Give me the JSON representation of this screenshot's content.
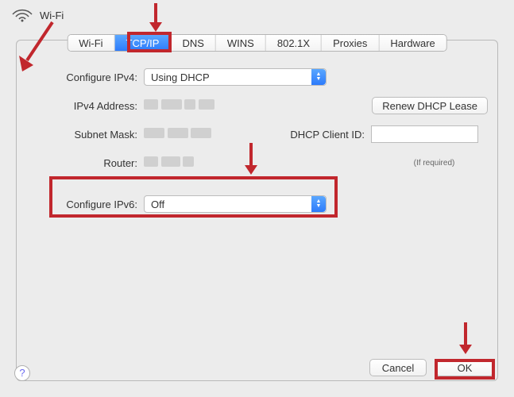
{
  "header": {
    "title": "Wi-Fi"
  },
  "tabs": {
    "t0": "Wi-Fi",
    "t1": "TCP/IP",
    "t2": "DNS",
    "t3": "WINS",
    "t4": "802.1X",
    "t5": "Proxies",
    "t6": "Hardware",
    "selected": "TCP/IP"
  },
  "ipv4": {
    "configure_label": "Configure IPv4:",
    "configure_value": "Using DHCP",
    "address_label": "IPv4 Address:",
    "subnet_label": "Subnet Mask:",
    "router_label": "Router:"
  },
  "dhcp": {
    "renew_button": "Renew DHCP Lease",
    "client_id_label": "DHCP Client ID:",
    "client_id_value": "",
    "note": "(If required)"
  },
  "ipv6": {
    "configure_label": "Configure IPv6:",
    "configure_value": "Off"
  },
  "buttons": {
    "cancel": "Cancel",
    "ok": "OK",
    "help": "?"
  },
  "colors": {
    "accent": "#2d7bfb",
    "annotation": "#c1272d"
  }
}
